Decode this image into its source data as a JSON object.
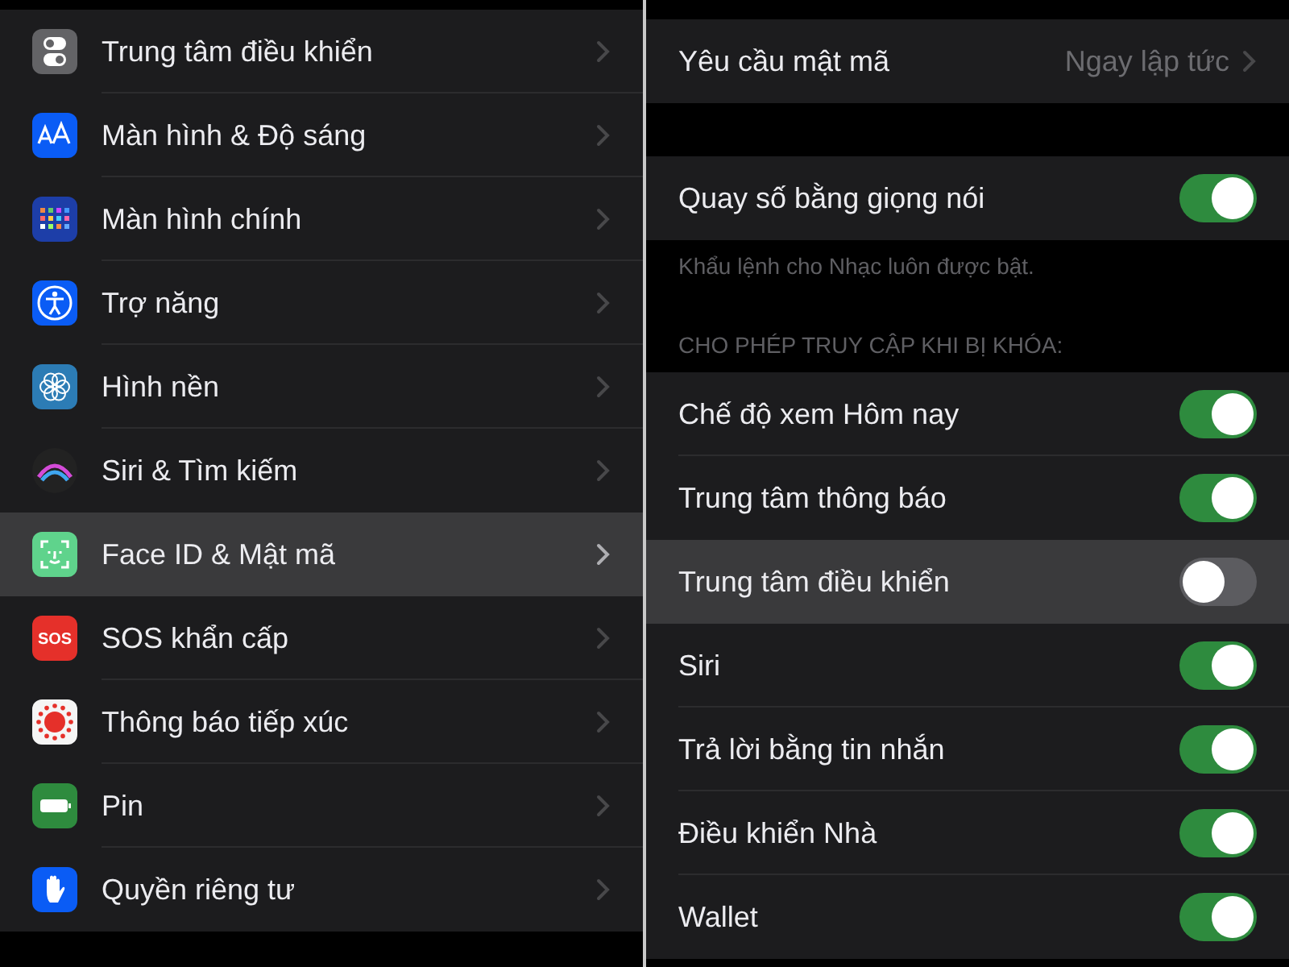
{
  "settings_list": [
    {
      "label": "Trung tâm điều khiển",
      "selected": false
    },
    {
      "label": "Màn hình & Độ sáng",
      "selected": false
    },
    {
      "label": "Màn hình chính",
      "selected": false
    },
    {
      "label": "Trợ năng",
      "selected": false
    },
    {
      "label": "Hình nền",
      "selected": false
    },
    {
      "label": "Siri & Tìm kiếm",
      "selected": false
    },
    {
      "label": "Face ID & Mật mã",
      "selected": true
    },
    {
      "label": "SOS khẩn cấp",
      "icon_text": "SOS",
      "selected": false
    },
    {
      "label": "Thông báo tiếp xúc",
      "selected": false
    },
    {
      "label": "Pin",
      "selected": false
    },
    {
      "label": "Quyền riêng tư",
      "selected": false
    }
  ],
  "passcode_settings": {
    "sections": [
      {
        "rows": [
          {
            "kind": "link",
            "label": "Yêu cầu mật mã",
            "value": "Ngay lập tức",
            "selected": false
          }
        ]
      },
      {
        "rows": [
          {
            "kind": "toggle",
            "label": "Quay số bằng giọng nói",
            "on": true,
            "selected": false
          }
        ],
        "footer": "Khẩu lệnh cho Nhạc luôn được bật."
      },
      {
        "header": "CHO PHÉP TRUY CẬP KHI BỊ KHÓA:",
        "rows": [
          {
            "kind": "toggle",
            "label": "Chế độ xem Hôm nay",
            "on": true,
            "selected": false
          },
          {
            "kind": "toggle",
            "label": "Trung tâm thông báo",
            "on": true,
            "selected": false
          },
          {
            "kind": "toggle",
            "label": "Trung tâm điều khiển",
            "on": false,
            "selected": true
          },
          {
            "kind": "toggle",
            "label": "Siri",
            "on": true,
            "selected": false
          },
          {
            "kind": "toggle",
            "label": "Trả lời bằng tin nhắn",
            "on": true,
            "selected": false
          },
          {
            "kind": "toggle",
            "label": "Điều khiển Nhà",
            "on": true,
            "selected": false
          },
          {
            "kind": "toggle",
            "label": "Wallet",
            "on": true,
            "selected": false
          }
        ]
      }
    ]
  }
}
